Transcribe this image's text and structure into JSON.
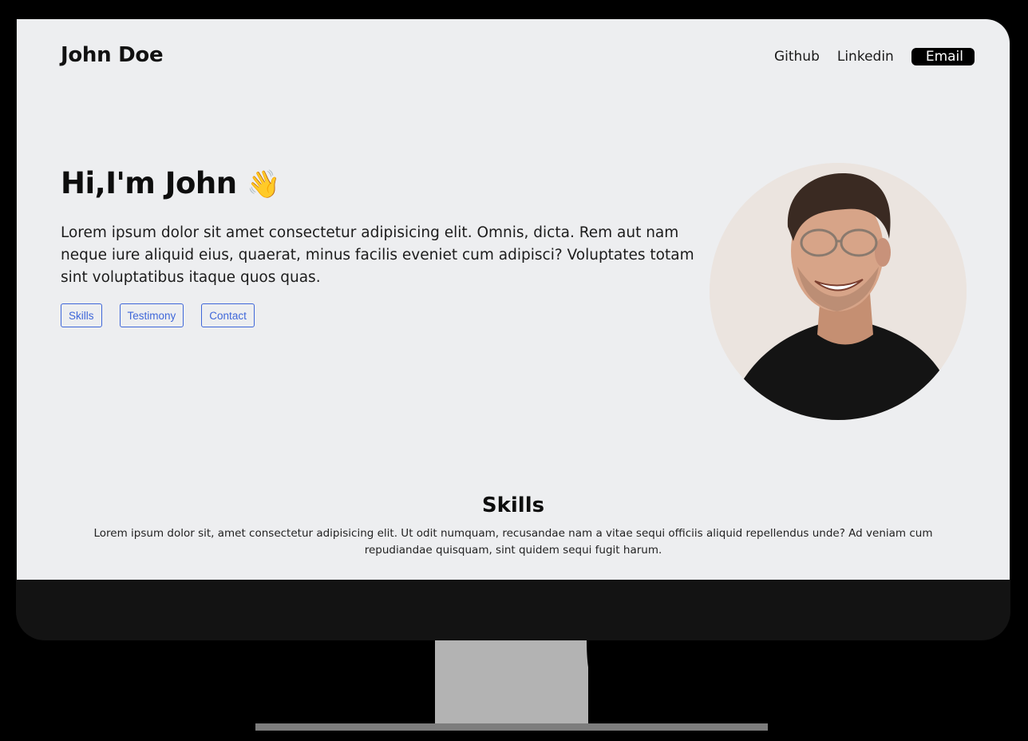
{
  "header": {
    "brand": "John Doe",
    "nav": {
      "github": "Github",
      "linkedin": "Linkedin",
      "email": "Email"
    }
  },
  "hero": {
    "title": "Hi,I'm John",
    "wave_emoji": "👋",
    "description": "Lorem ipsum dolor sit amet consectetur adipisicing elit. Omnis, dicta. Rem aut nam neque iure aliquid eius, quaerat, minus facilis eveniet cum adipisci? Voluptates totam sint voluptatibus itaque quos quas.",
    "buttons": {
      "skills": "Skills",
      "testimony": "Testimony",
      "contact": "Contact"
    },
    "accent_color": "#3f67d9"
  },
  "skills": {
    "title": "Skills",
    "description": "Lorem ipsum dolor sit, amet consectetur adipisicing elit. Ut odit numquam, recusandae nam a vitae sequi officiis aliquid repellendus unde? Ad veniam cum repudiandae quisquam, sint quidem sequi fugit harum."
  },
  "colors": {
    "screen_background": "#edeef0",
    "monitor_bezel": "#131313",
    "stand": "#b3b3b3"
  }
}
